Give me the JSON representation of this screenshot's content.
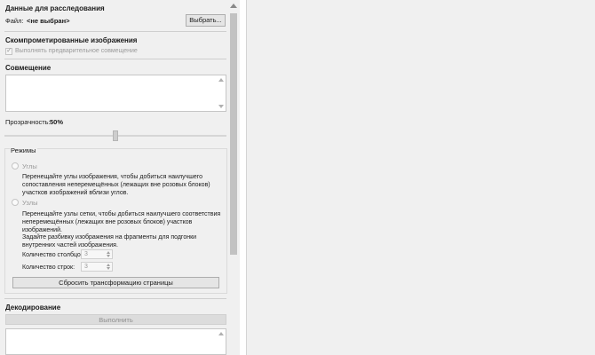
{
  "investigation": {
    "title": "Данные для расследования",
    "file_label": "Файл:",
    "file_value": "<не выбран>",
    "choose_button": "Выбрать..."
  },
  "compromised": {
    "title": "Скомпрометированные изображения",
    "checkbox_label": "Выполнять предварительное совмещение",
    "checkbox_checked": true
  },
  "alignment": {
    "title": "Совмещение",
    "opacity_label": "Прозрачность:",
    "opacity_value": "50%",
    "opacity_fraction": 0.5
  },
  "modes": {
    "title": "Режимы",
    "corners_label": "Углы",
    "corners_desc_1": "Перенещайте углы изображения, чтобы добиться наилучшего",
    "corners_desc_2": "сопоставления неперемещённых (лежащих вне розовых блоков)",
    "corners_desc_3": "участков изображений вблизи углов.",
    "nodes_label": "Узлы",
    "nodes_desc_1": "Перенещайте узлы сетки, чтобы добиться наилучшего соответствия",
    "nodes_desc_2": "неперемещённых (лежащих вне розовых блоков) участков",
    "nodes_desc_3": "изображений.",
    "nodes_desc_4": "Задайте разбивку изображения на фрагменты для подгонки",
    "nodes_desc_5": "внутренних частей изображения.",
    "columns_label": "Количество столбцов:",
    "columns_value": "3",
    "rows_label": "Количество строк:",
    "rows_value": "3",
    "reset_button": "Сбросить трансформацию страницы"
  },
  "decoding": {
    "title": "Декодирование",
    "run_button": "Выполнить"
  }
}
